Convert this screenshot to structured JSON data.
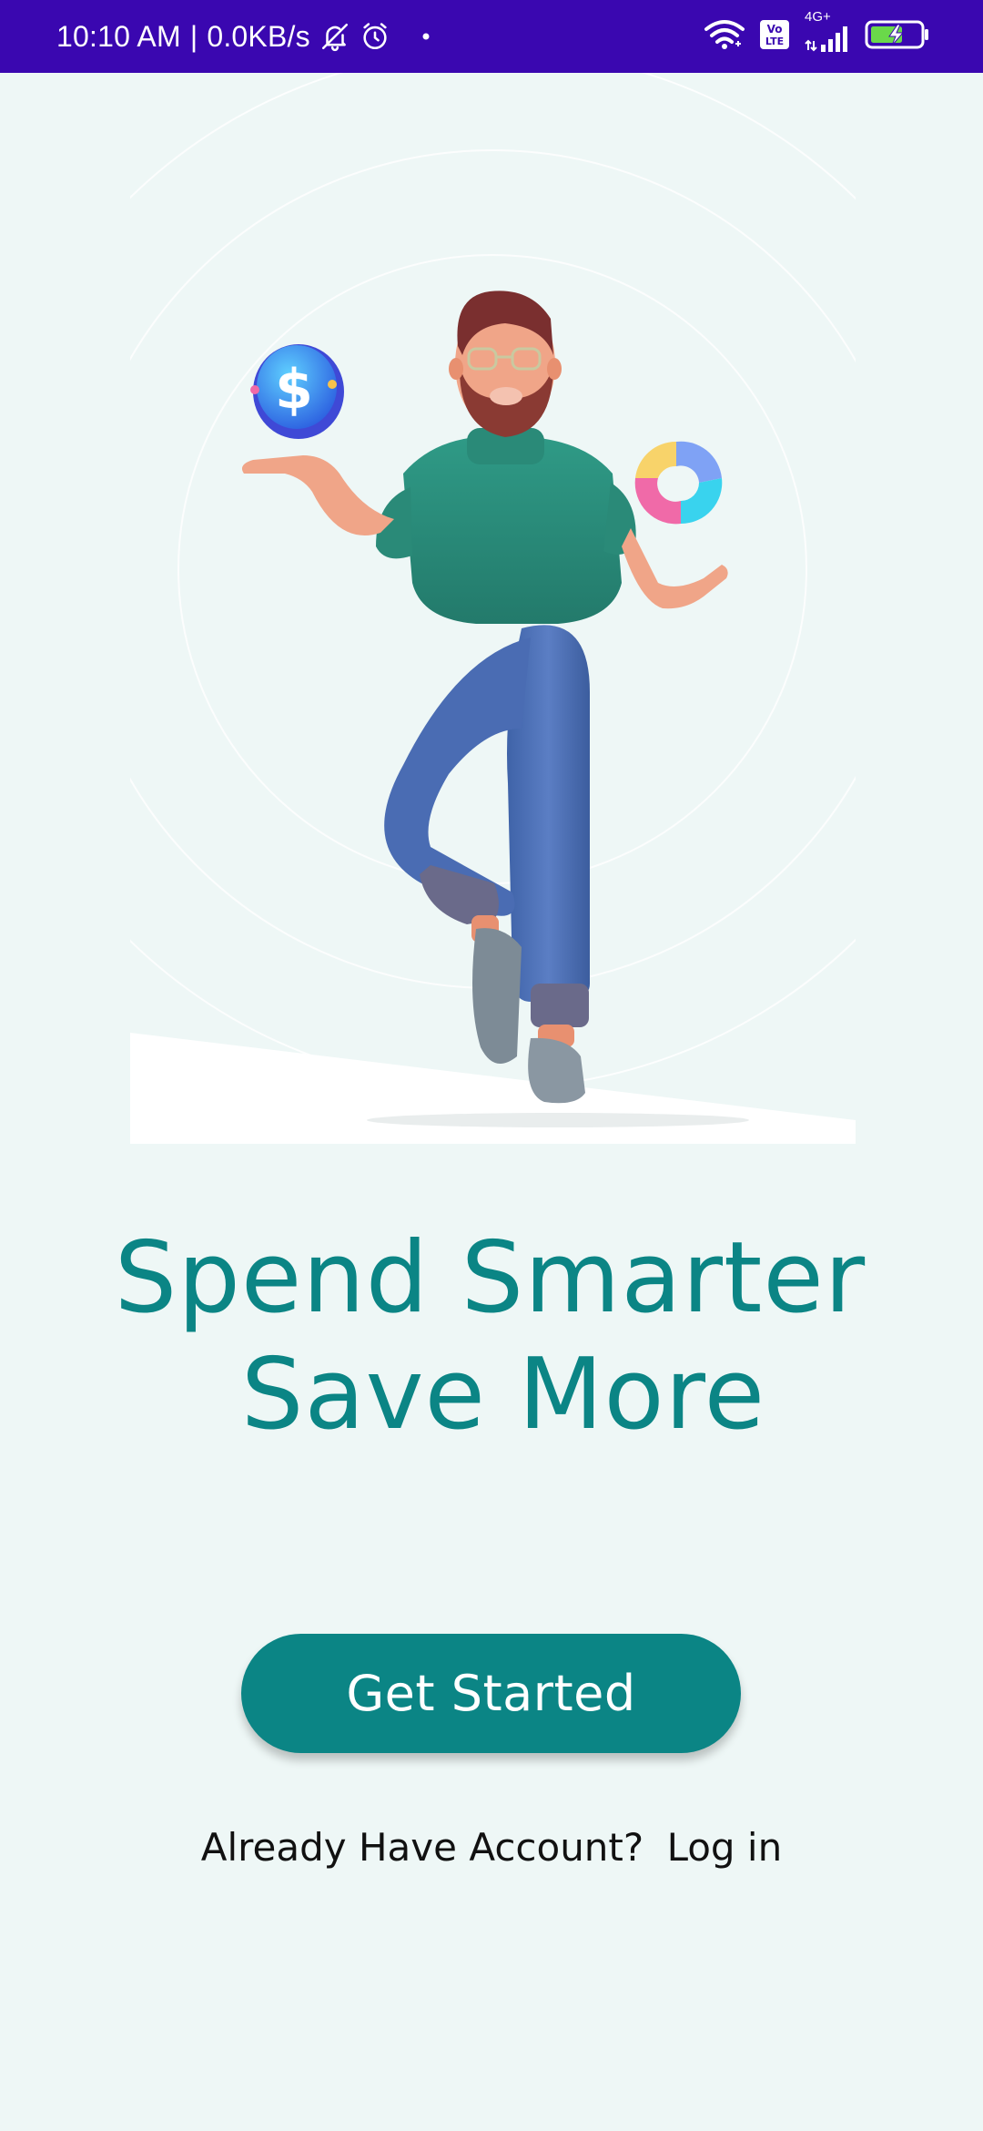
{
  "status_bar": {
    "time": "10:10 AM",
    "separator": "|",
    "speed": "0.0KB/s",
    "network_type": "4G+",
    "volte_label": "Vo LTE",
    "background": "#3a07b0"
  },
  "icons": {
    "mute": "bell-off-icon",
    "alarm": "alarm-icon",
    "wifi": "wifi-icon",
    "signal": "signal-icon",
    "battery": "battery-charging-icon"
  },
  "onboarding": {
    "headline_line1": "Spend Smarter",
    "headline_line2": "Save More",
    "primary_button": "Get Started",
    "login_prompt": "Already Have Account?",
    "login_link": "Log in"
  },
  "colors": {
    "background": "#eef7f6",
    "accent": "#0b8585"
  }
}
